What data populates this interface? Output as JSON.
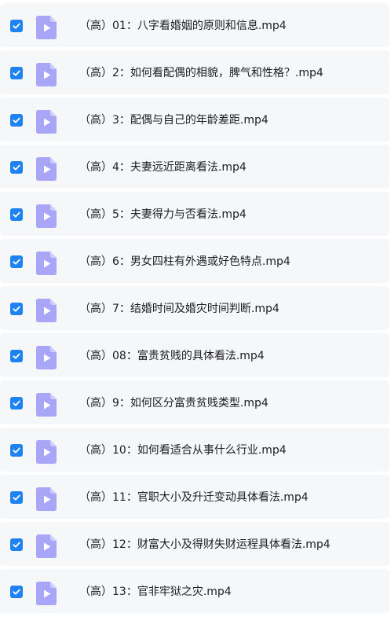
{
  "files": [
    {
      "name": "（高）01：八字看婚姻的原则和信息.mp4",
      "checked": true
    },
    {
      "name": "（高）2：如何看配偶的相貌，脾气和性格？.mp4",
      "checked": true
    },
    {
      "name": "（高）3：配偶与自己的年龄差距.mp4",
      "checked": true
    },
    {
      "name": "（高）4：夫妻远近距离看法.mp4",
      "checked": true
    },
    {
      "name": "（高）5：夫妻得力与否看法.mp4",
      "checked": true
    },
    {
      "name": "（高）6：男女四柱有外遇或好色特点.mp4",
      "checked": true
    },
    {
      "name": "（高）7：结婚时间及婚灾时间判断.mp4",
      "checked": true
    },
    {
      "name": "（高）08：富贵贫贱的具体看法.mp4",
      "checked": true
    },
    {
      "name": "（高）9：如何区分富贵贫贱类型.mp4",
      "checked": true
    },
    {
      "name": "（高）10：如何看适合从事什么行业.mp4",
      "checked": true
    },
    {
      "name": "（高）11：官职大小及升迁变动具体看法.mp4",
      "checked": true
    },
    {
      "name": "（高）12：财富大小及得财失财运程具体看法.mp4",
      "checked": true
    },
    {
      "name": "（高）13：官非牢狱之灾.mp4",
      "checked": true
    }
  ],
  "colors": {
    "checkbox": "#1e82f2",
    "video_icon": "#a9a6f8",
    "row_background": "#f6f7f9",
    "text": "#1d1d1f"
  },
  "icons": {
    "checkbox": "checkmark-icon",
    "file": "video-file-icon"
  }
}
